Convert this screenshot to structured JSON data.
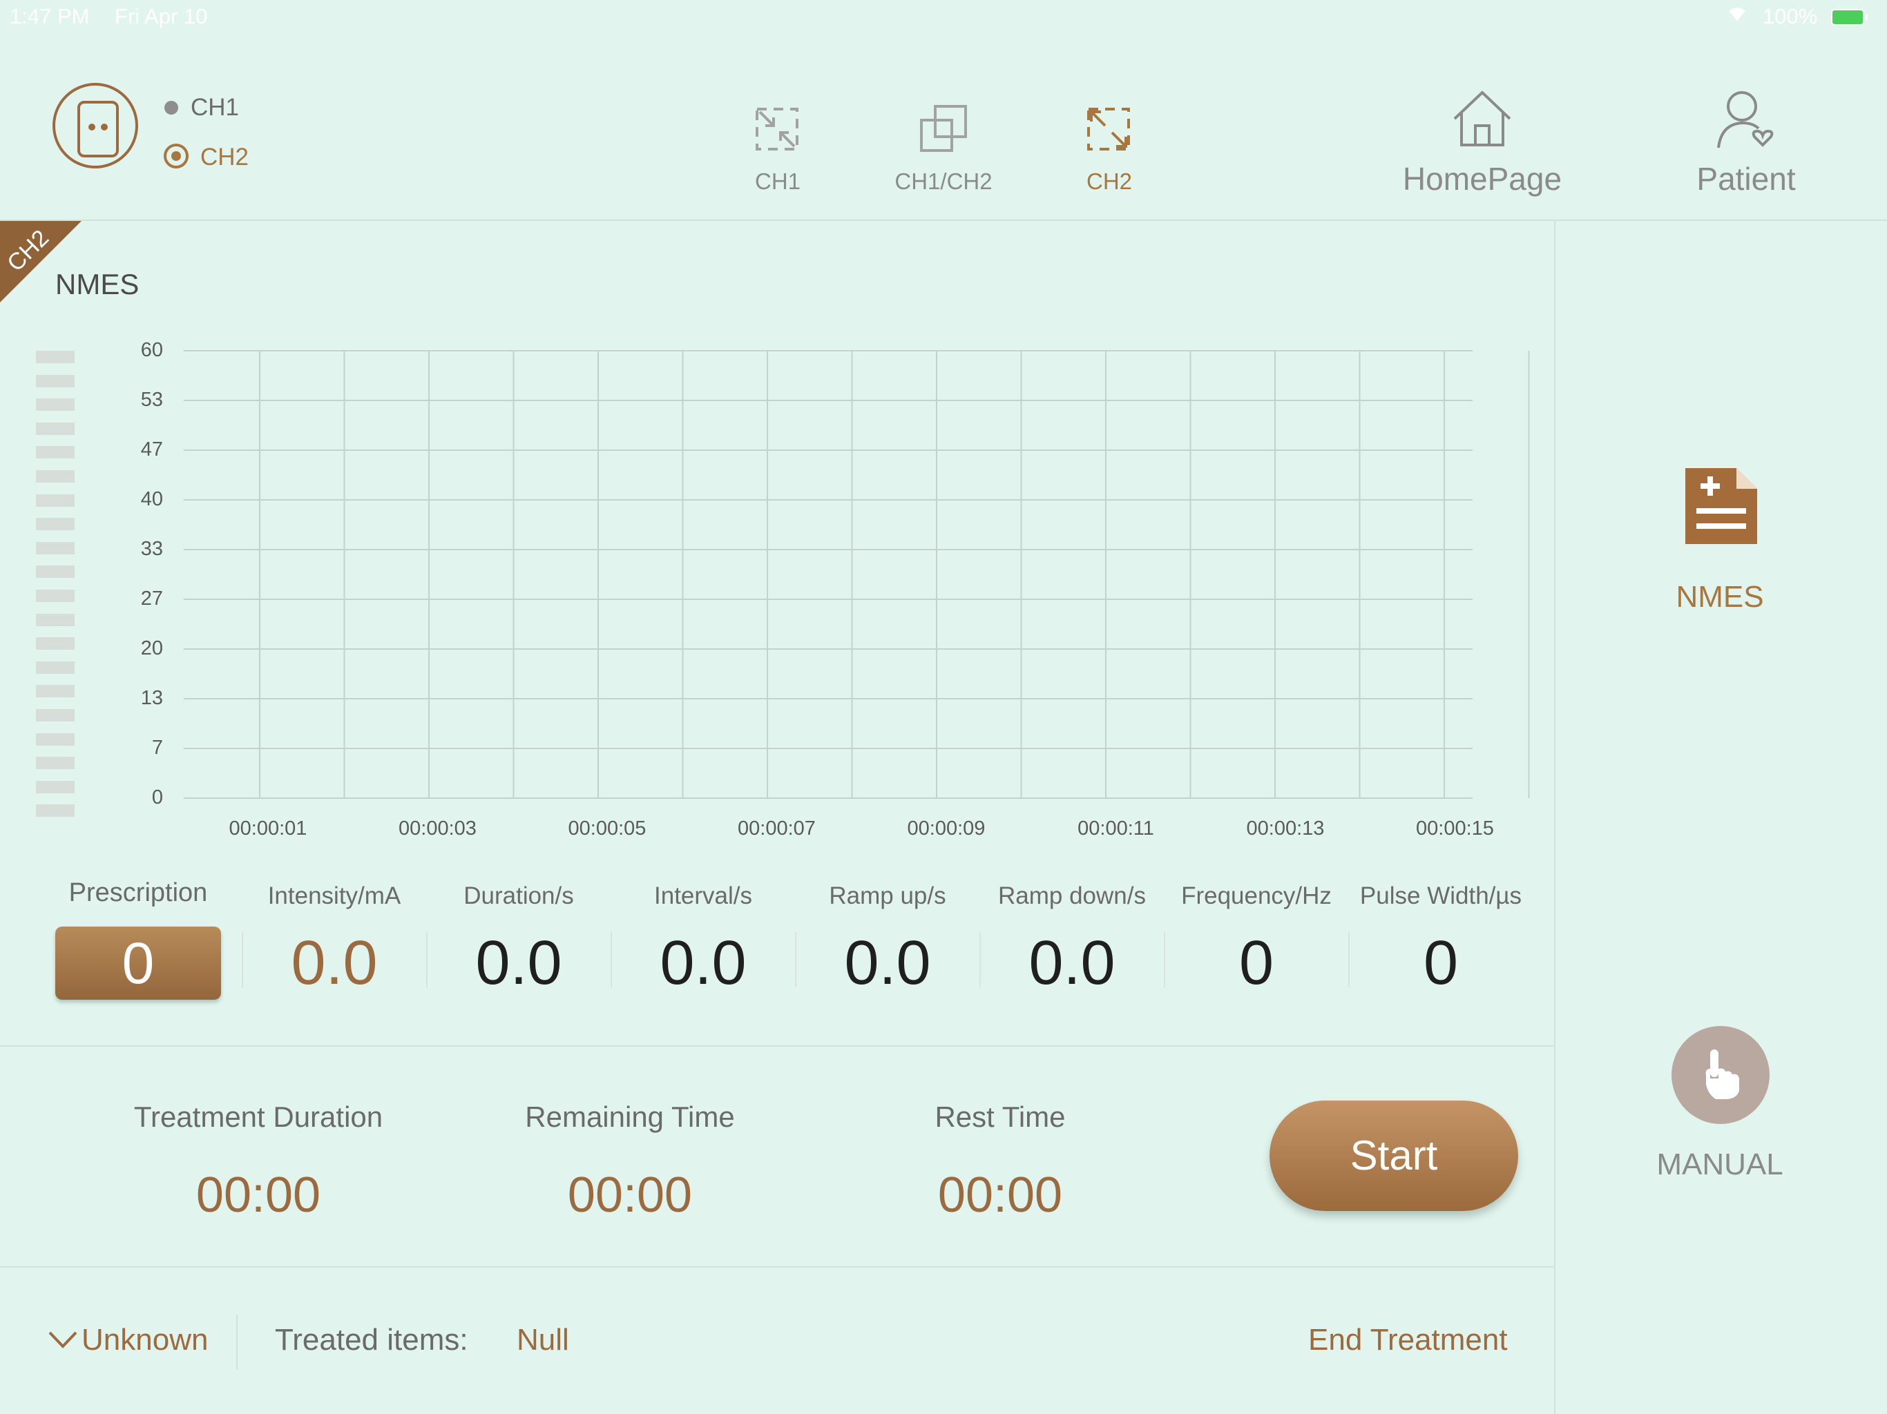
{
  "status_bar": {
    "time": "1:47 PM",
    "date": "Fri Apr 10",
    "battery": "100%"
  },
  "header": {
    "channels": [
      {
        "label": "CH1",
        "selected": false
      },
      {
        "label": "CH2",
        "selected": true
      }
    ],
    "views": [
      {
        "label": "CH1",
        "icon": "collapse-icon",
        "active": false
      },
      {
        "label": "CH1/CH2",
        "icon": "copy-icon",
        "active": false
      },
      {
        "label": "CH2",
        "icon": "expand-icon",
        "active": true
      }
    ],
    "nav": [
      {
        "label": "HomePage",
        "icon": "home-icon"
      },
      {
        "label": "Patient",
        "icon": "patient-icon"
      }
    ]
  },
  "channel_badge": "CH2",
  "mode_title": "NMES",
  "chart_data": {
    "type": "line",
    "ylim": [
      0,
      60
    ],
    "yticks": [
      "60",
      "53",
      "47",
      "40",
      "33",
      "27",
      "20",
      "13",
      "7",
      "0"
    ],
    "xticks": [
      "00:00:01",
      "00:00:03",
      "00:00:05",
      "00:00:07",
      "00:00:09",
      "00:00:11",
      "00:00:13",
      "00:00:15"
    ],
    "grid": true,
    "series": [],
    "intensity_level_segments": 20,
    "intensity_level_filled": 0
  },
  "params": {
    "prescription": {
      "label": "Prescription",
      "value": "0"
    },
    "items": [
      {
        "label": "Intensity/mA",
        "value": "0.0",
        "accent": true
      },
      {
        "label": "Duration/s",
        "value": "0.0"
      },
      {
        "label": "Interval/s",
        "value": "0.0"
      },
      {
        "label": "Ramp up/s",
        "value": "0.0"
      },
      {
        "label": "Ramp down/s",
        "value": "0.0"
      },
      {
        "label": "Frequency/Hz",
        "value": "0"
      },
      {
        "label": "Pulse Width/µs",
        "value": "0"
      }
    ]
  },
  "times": [
    {
      "label": "Treatment Duration",
      "value": "00:00"
    },
    {
      "label": "Remaining Time",
      "value": "00:00"
    },
    {
      "label": "Rest Time",
      "value": "00:00"
    }
  ],
  "start_label": "Start",
  "footer": {
    "dropdown": "Unknown",
    "treated_label": "Treated items:",
    "treated_value": "Null",
    "end_label": "End Treatment"
  },
  "sidebar": {
    "mode_label": "NMES",
    "manual_label": "MANUAL"
  },
  "colors": {
    "accent": "#9b6b3f",
    "background": "#e1f5ee",
    "gray": "#8a8a8a"
  }
}
